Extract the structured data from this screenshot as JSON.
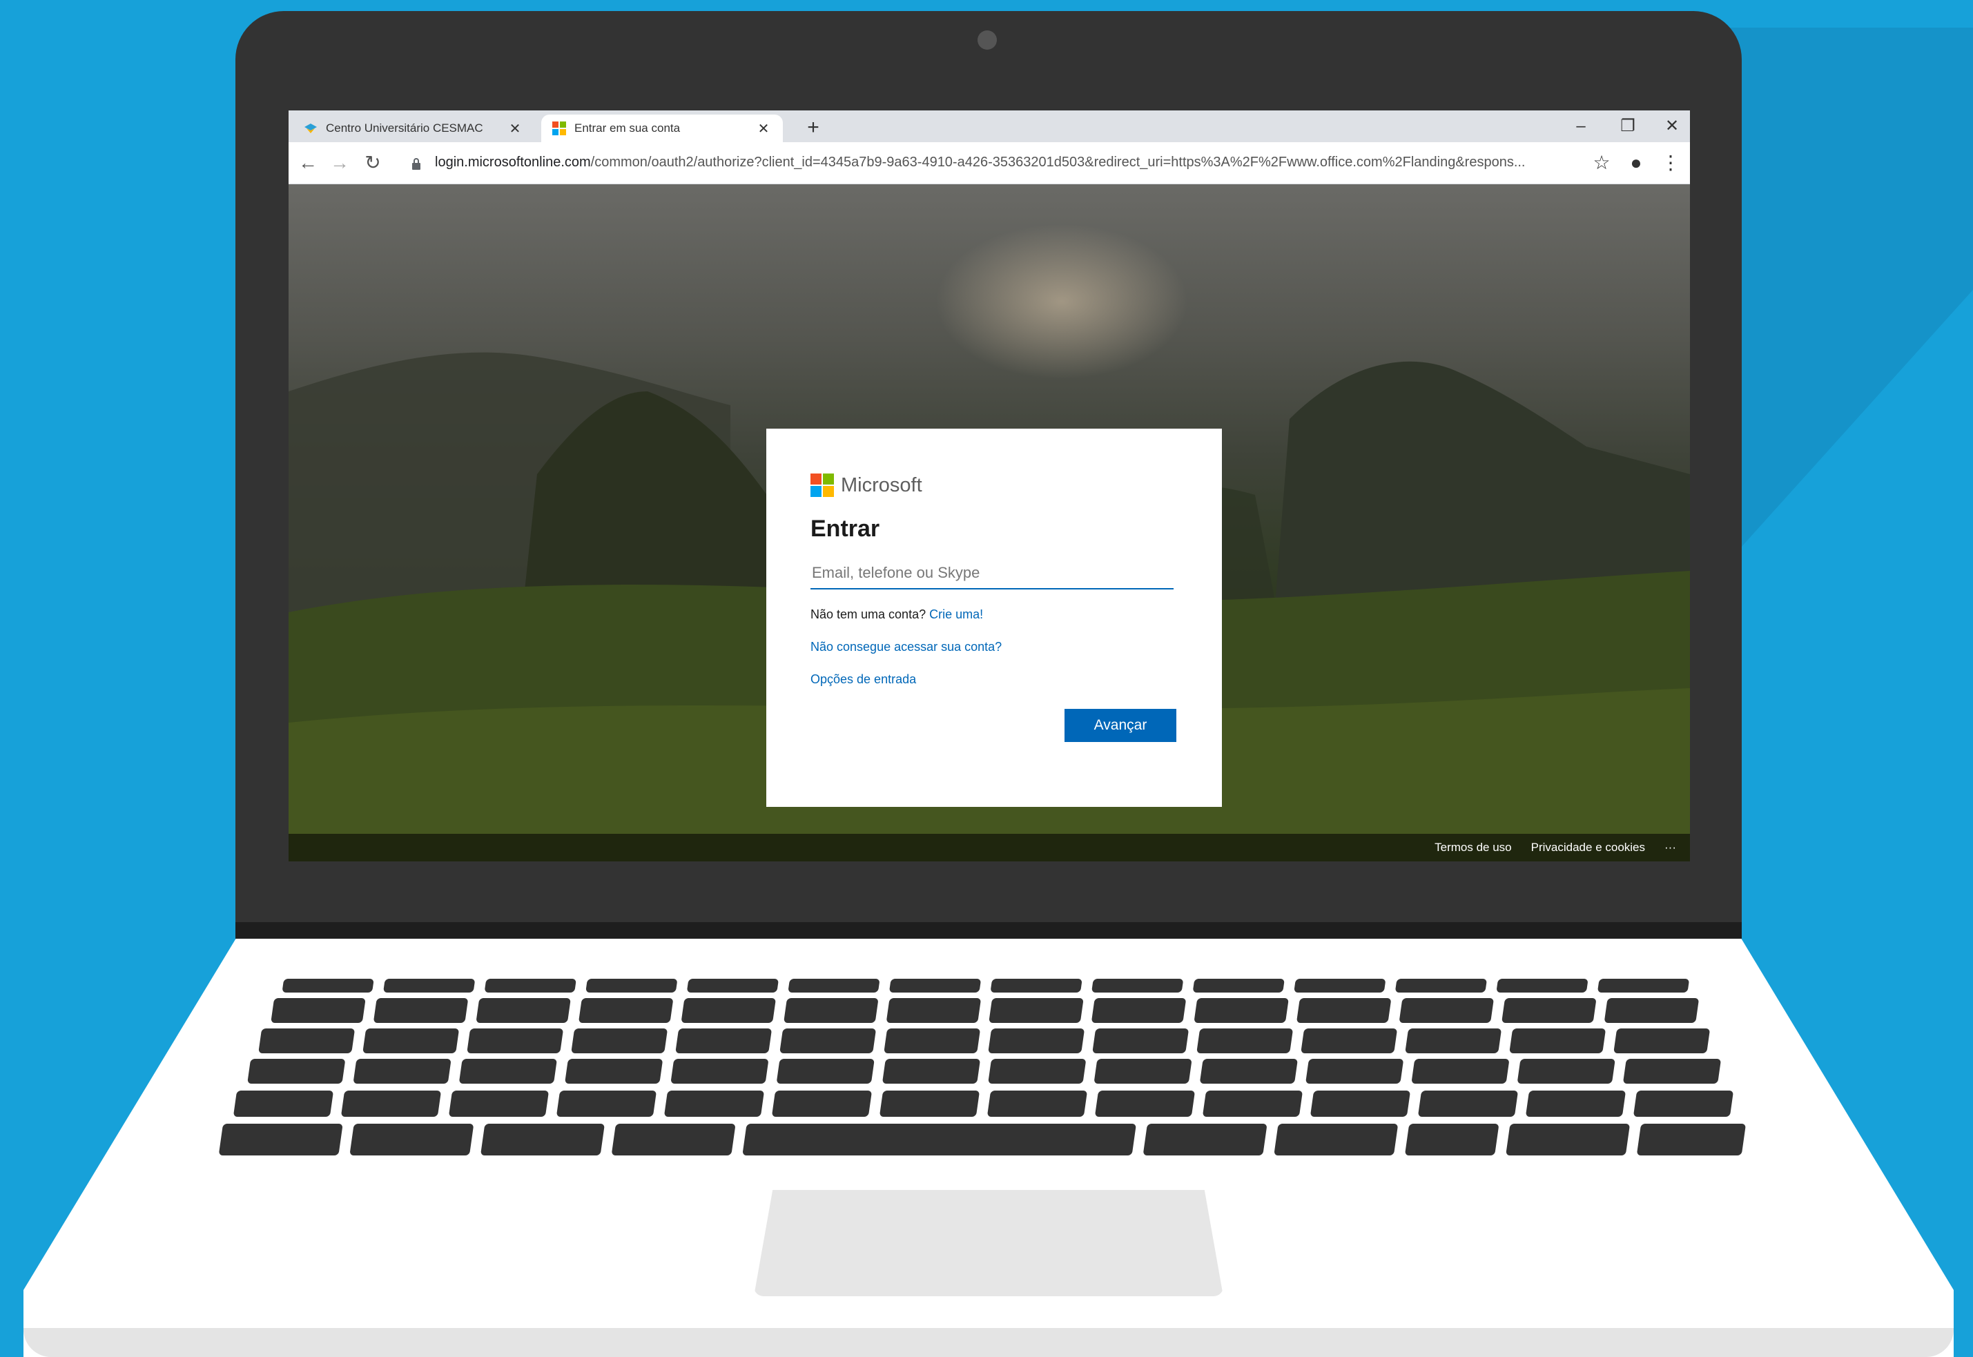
{
  "browser": {
    "tabs": [
      {
        "label": "Centro Universitário CESMAC",
        "close": "✕"
      },
      {
        "label": "Entrar em sua conta",
        "close": "✕"
      }
    ],
    "new_tab": "+",
    "window_controls": {
      "minimize": "–",
      "restore": "❐",
      "close": "✕"
    },
    "nav": {
      "back": "←",
      "forward": "→",
      "reload": "↻"
    },
    "url_host": "login.microsoftonline.com",
    "url_rest": "/common/oauth2/authorize?client_id=4345a7b9-9a63-4910-a426-35363201d503&redirect_uri=https%3A%2F%2Fwww.office.com%2Flanding&respons...",
    "toolbar_icons": {
      "star": "☆",
      "profile": "●",
      "menu": "⋮"
    }
  },
  "signin": {
    "brand": "Microsoft",
    "title": "Entrar",
    "email_placeholder": "Email, telefone ou Skype",
    "no_account_text": "Não tem uma conta?",
    "create_link": "Crie uma!",
    "cant_access_link": "Não consegue acessar sua conta?",
    "signin_options_link": "Opções de entrada",
    "next_button": "Avançar"
  },
  "footer": {
    "terms": "Termos de uso",
    "privacy": "Privacidade e cookies",
    "more": "···"
  },
  "colors": {
    "background": "#17a1d9",
    "accent": "#0067b8",
    "ms_red": "#f25022",
    "ms_green": "#7fba00",
    "ms_blue": "#00a4ef",
    "ms_yellow": "#ffb900"
  }
}
